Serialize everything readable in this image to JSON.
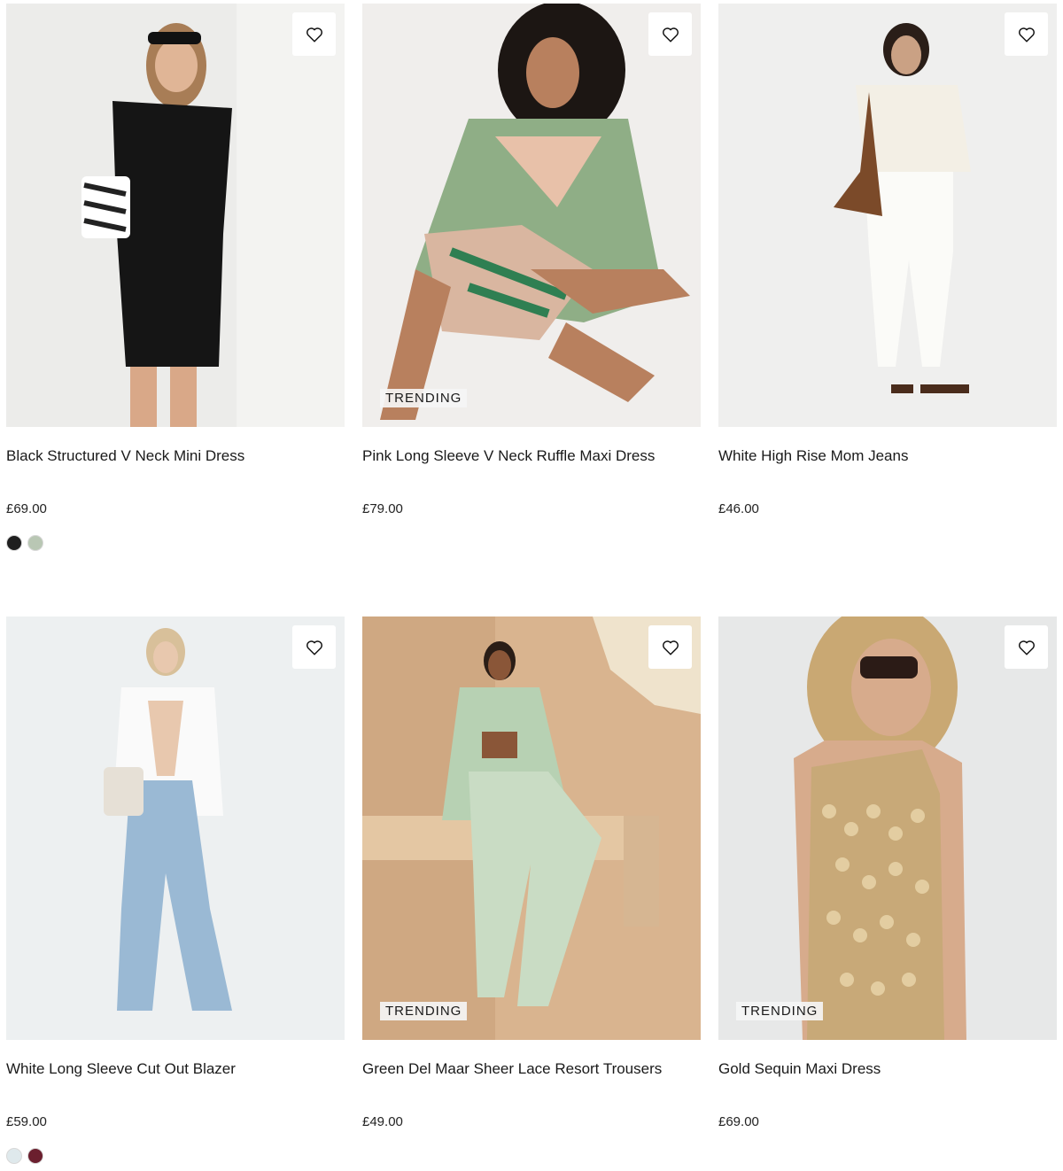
{
  "products": [
    {
      "title": "Black Structured V Neck Mini Dress",
      "price": "£69.00",
      "badge": "",
      "image": "model-black-mini-dress",
      "swatches": [
        "#1f1f1f",
        "#b9c7b4"
      ]
    },
    {
      "title": "Pink Long Sleeve V Neck Ruffle Maxi Dress",
      "price": "£79.00",
      "badge": "TRENDING",
      "image": "model-floral-ruffle-dress",
      "swatches": []
    },
    {
      "title": "White High Rise Mom Jeans",
      "price": "£46.00",
      "badge": "",
      "image": "model-white-jeans",
      "swatches": []
    },
    {
      "title": "White Long Sleeve Cut Out Blazer",
      "price": "£59.00",
      "badge": "",
      "image": "model-white-blazer",
      "swatches": [
        "#dfe9ec",
        "#6b1f2e"
      ]
    },
    {
      "title": "Green Del Maar Sheer Lace Resort Trousers",
      "price": "£49.00",
      "badge": "TRENDING",
      "image": "model-lace-resort-set",
      "swatches": []
    },
    {
      "title": "Gold Sequin Maxi Dress",
      "price": "£69.00",
      "badge": "TRENDING",
      "image": "model-gold-sequin-dress",
      "swatches": []
    }
  ],
  "icons": {
    "wishlist": "heart-outline-icon"
  }
}
